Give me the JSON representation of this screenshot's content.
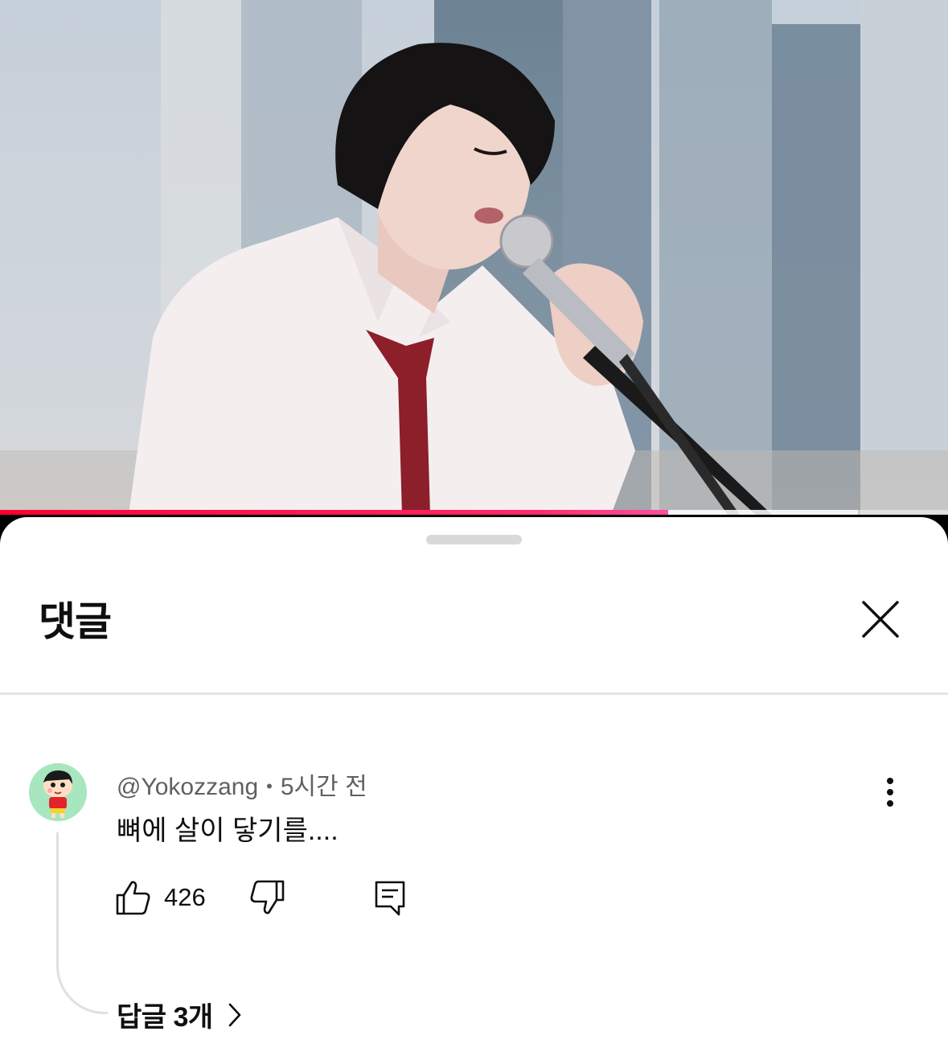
{
  "video": {
    "progress_percent": 70.5,
    "buffered_percent": 90.5
  },
  "comments_sheet": {
    "title": "댓글",
    "close_icon": "close-icon"
  },
  "comment": {
    "author": "@Yokozzang",
    "separator": "•",
    "time": "5시간 전",
    "text": "뼈에 살이 닿기를....",
    "like_count": "426",
    "replies_label": "답글 3개"
  },
  "icons": {
    "like": "thumbs-up-icon",
    "dislike": "thumbs-down-icon",
    "reply": "reply-comment-icon",
    "more": "more-vertical-icon",
    "chevron": "chevron-right-icon"
  }
}
